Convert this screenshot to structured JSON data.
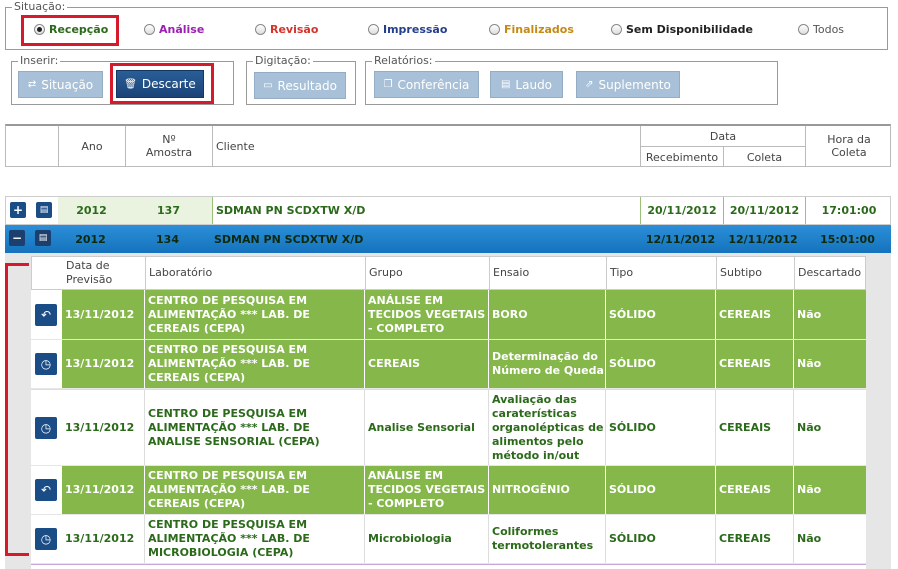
{
  "situacao": {
    "legend": "Situação:",
    "options": [
      {
        "label": "Recepção",
        "selected": true,
        "color": "#2b6a1a"
      },
      {
        "label": "Análise",
        "selected": false,
        "color": "#9b1fb0"
      },
      {
        "label": "Revisão",
        "selected": false,
        "color": "#d2342b"
      },
      {
        "label": "Impressão",
        "selected": false,
        "color": "#243f8c"
      },
      {
        "label": "Finalizados",
        "selected": false,
        "color": "#c58a13"
      },
      {
        "label": "Sem Disponibilidade",
        "selected": false,
        "color": "#222222"
      },
      {
        "label": "Todos",
        "selected": false,
        "color": "#555555"
      }
    ]
  },
  "inserir": {
    "legend": "Inserir:",
    "situacao_label": "Situação",
    "descarte_label": "Descarte"
  },
  "digitacao": {
    "legend": "Digitação:",
    "resultado_label": "Resultado"
  },
  "relatorios": {
    "legend": "Relatórios:",
    "conferencia_label": "Conferência",
    "laudo_label": "Laudo",
    "suplemento_label": "Suplemento"
  },
  "table_header": {
    "ano": "Ano",
    "no_amostra": "Nº Amostra",
    "cliente": "Cliente",
    "data": "Data",
    "recebimento": "Recebimento",
    "coleta": "Coleta",
    "hora_coleta": "Hora da Coleta"
  },
  "samples": [
    {
      "ano": "2012",
      "amostra": "137",
      "cliente": "SDMAN PN SCDXTW X/D",
      "recebimento": "20/11/2012",
      "coleta": "20/11/2012",
      "hora": "17:01:00",
      "expanded": false,
      "expand_icon": "plus-icon"
    },
    {
      "ano": "2012",
      "amostra": "134",
      "cliente": "SDMAN PN SCDXTW X/D",
      "recebimento": "12/11/2012",
      "coleta": "12/11/2012",
      "hora": "15:01:00",
      "expanded": true,
      "expand_icon": "minus-icon"
    }
  ],
  "sub_header": {
    "data_previsao": "Data de Previsão",
    "laboratorio": "Laboratório",
    "grupo": "Grupo",
    "ensaio": "Ensaio",
    "tipo": "Tipo",
    "subtipo": "Subtipo",
    "descartado": "Descartado"
  },
  "sub_rows": [
    {
      "icon": "undo-icon",
      "style": "green",
      "data": "13/11/2012",
      "laboratorio": "CENTRO DE PESQUISA EM ALIMENTAÇÃO *** LAB. DE CEREAIS (CEPA)",
      "grupo": "ANÁLISE EM TECIDOS VEGETAIS - COMPLETO",
      "ensaio": "BORO",
      "tipo": "SÓLIDO",
      "subtipo": "CEREAIS",
      "descartado": "Não"
    },
    {
      "icon": "clock-icon",
      "style": "green",
      "data": "13/11/2012",
      "laboratorio": "CENTRO DE PESQUISA EM ALIMENTAÇÃO *** LAB. DE CEREAIS (CEPA)",
      "grupo": "CEREAIS",
      "ensaio": "Determinação do Número de Queda",
      "tipo": "SÓLIDO",
      "subtipo": "CEREAIS",
      "descartado": "Não"
    },
    {
      "icon": "clock-icon",
      "style": "white",
      "data": "13/11/2012",
      "laboratorio": "CENTRO DE PESQUISA EM ALIMENTAÇÃO *** LAB. DE ANALISE SENSORIAL (CEPA)",
      "grupo": "Analise Sensorial",
      "ensaio": "Avaliação das caraterísticas organolépticas de alimentos pelo método in/out",
      "tipo": "SÓLIDO",
      "subtipo": "CEREAIS",
      "descartado": "Não"
    },
    {
      "icon": "undo-icon",
      "style": "green",
      "data": "13/11/2012",
      "laboratorio": "CENTRO DE PESQUISA EM ALIMENTAÇÃO *** LAB. DE CEREAIS (CEPA)",
      "grupo": "ANÁLISE EM TECIDOS VEGETAIS - COMPLETO",
      "ensaio": "NITROGÊNIO",
      "tipo": "SÓLIDO",
      "subtipo": "CEREAIS",
      "descartado": "Não"
    },
    {
      "icon": "clock-icon",
      "style": "white",
      "data": "13/11/2012",
      "laboratorio": "CENTRO DE PESQUISA EM ALIMENTAÇÃO *** LAB. DE MICROBIOLOGIA (CEPA)",
      "grupo": "Microbiologia",
      "ensaio": "Coliformes termotolerantes",
      "tipo": "SÓLIDO",
      "subtipo": "CEREAIS",
      "descartado": "Não"
    }
  ]
}
